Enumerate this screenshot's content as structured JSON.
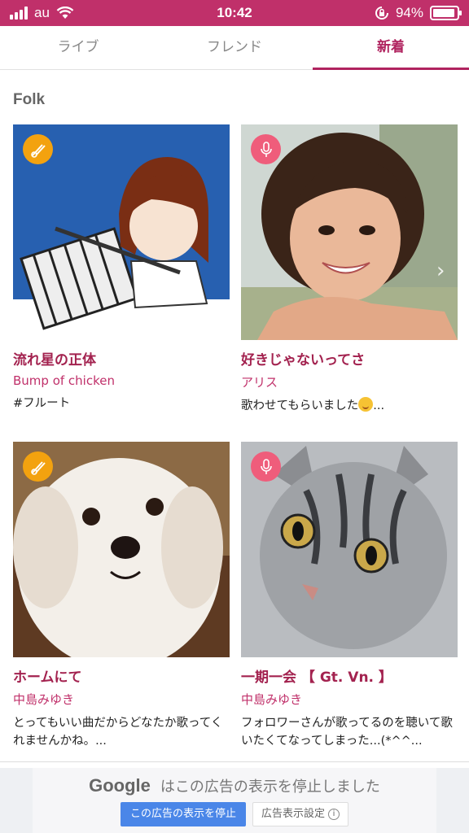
{
  "status_bar": {
    "carrier": "au",
    "time": "10:42",
    "battery_percent": "94%",
    "battery_level": 0.94
  },
  "tabs": [
    {
      "label": "ライブ",
      "active": false
    },
    {
      "label": "フレンド",
      "active": false
    },
    {
      "label": "新着",
      "active": true
    }
  ],
  "section": {
    "title": "Folk"
  },
  "cards": [
    {
      "badge": "instrument-icon",
      "title": "流れ星の正体",
      "artist": "Bump of chicken",
      "desc": "#フルート"
    },
    {
      "badge": "mic-icon",
      "title": "好きじゃないってさ",
      "artist": "アリス",
      "desc": "歌わせてもらいました",
      "desc_suffix": "..."
    },
    {
      "badge": "instrument-icon",
      "title": "ホームにて",
      "artist": "中島みゆき",
      "desc": "とってもいい曲だからどなたか歌ってくれませんかね。..."
    },
    {
      "badge": "mic-icon",
      "title": "一期一会 【 Gt. Vn. 】",
      "artist": "中島みゆき",
      "desc": "フォロワーさんが歌ってるのを聴いて歌いたくてなってしまった...(*^^..."
    }
  ],
  "ad": {
    "brand": "Google",
    "message": "はこの広告の表示を停止しました",
    "stop_button": "この広告の表示を停止",
    "settings_button": "広告表示設定"
  },
  "colors": {
    "accent": "#c0306a",
    "title": "#a3224f",
    "instrument_badge": "#f3a20f",
    "mic_badge": "#ef5d7b"
  }
}
